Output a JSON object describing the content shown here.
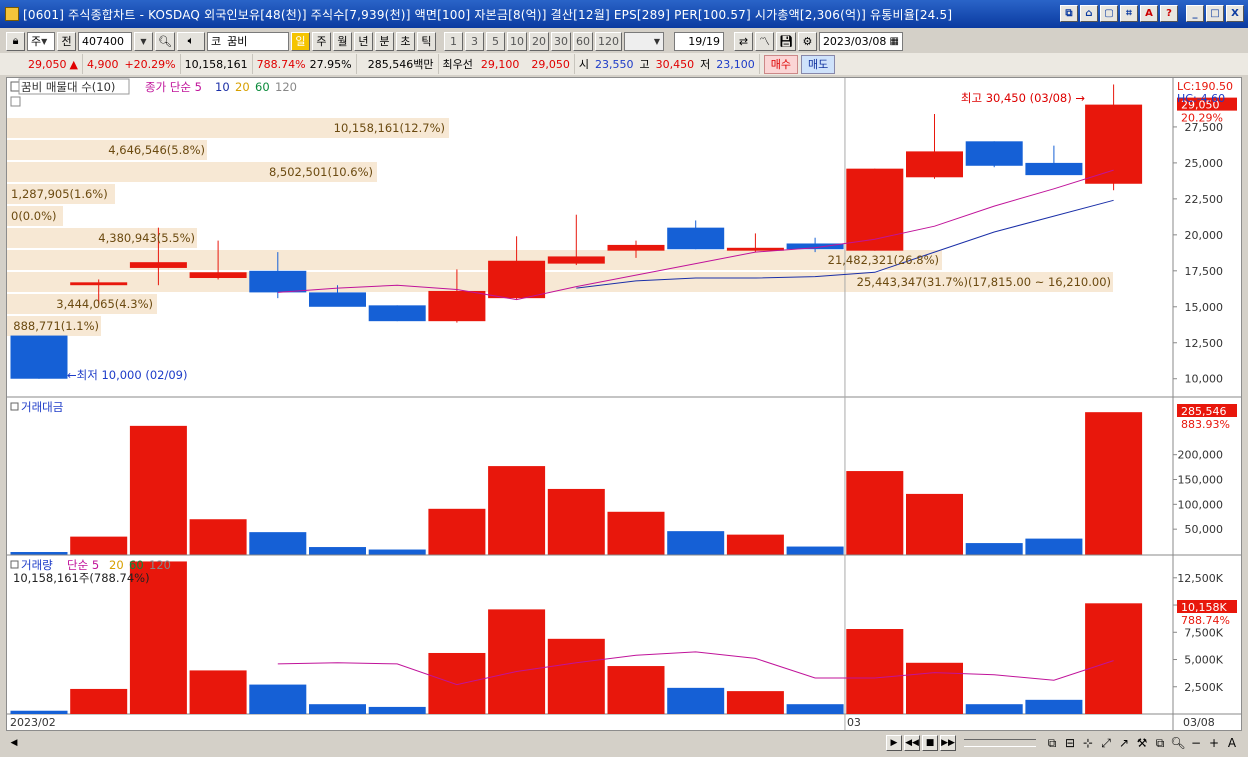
{
  "window": {
    "title": "[0601] 주식종합차트 - KOSDAQ 외국인보유[48(천)] 주식수[7,939(천)] 액면[100] 자본금[8(억)] 결산[12월] EPS[289] PER[100.57] 시가총액[2,306(억)] 유통비율[24.5]",
    "buttons": [
      "⧉",
      "⌂",
      "▢",
      "⌗",
      "A",
      "?",
      "_",
      "□",
      "X"
    ]
  },
  "toolbar": {
    "period_type": "주",
    "prev_label": "전",
    "code": "407400",
    "market": "코",
    "stock_name": "꿈비",
    "period_buttons": [
      "일",
      "주",
      "월",
      "년",
      "분",
      "초",
      "틱"
    ],
    "active_period": "일",
    "interval_buttons": [
      "1",
      "3",
      "5",
      "10",
      "20",
      "30",
      "60",
      "120"
    ],
    "count": "19",
    "count_total": "/19",
    "date": "2023/03/08"
  },
  "quote": {
    "price": "29,050",
    "up_arrow": "▲",
    "change": "4,900",
    "change_pct": "+20.29%",
    "volume": "10,158,161",
    "volume_ratio": "788.74%",
    "turnover": "27.95%",
    "amount": "285,546백만",
    "best_label": "최우선",
    "bid1": "29,100",
    "bid2": "29,050",
    "open_label": "시",
    "open": "23,550",
    "high_label": "고",
    "high": "30,450",
    "low_label": "저",
    "low": "23,100",
    "buy": "매수",
    "sell": "매도"
  },
  "price_panel": {
    "legend_name": "꿈비 매물대 수(10)",
    "legend_ma": "종가 단순 5",
    "ma_periods": [
      "10",
      "20",
      "60",
      "120"
    ],
    "lc": "LC:190.50",
    "hc": "HC:-4.60",
    "current": "29,050",
    "current_pct": "20.29%",
    "high_note": "최고 30,450 (03/08) →",
    "low_note": "←최저 10,000 (02/09)",
    "y_ticks": [
      "27,500",
      "25,000",
      "22,500",
      "20,000",
      "17,500",
      "15,000",
      "12,500",
      "10,000"
    ],
    "profile_labels": [
      "10,158,161(12.7%)",
      "4,646,546(5.8%)",
      "8,502,501(10.6%)",
      "1,287,905(1.6%)",
      "0(0.0%)",
      "4,380,943(5.5%)",
      "21,482,321(26.8%)",
      "25,443,347(31.7%)(17,815.00 ~ 16,210.00)",
      "3,444,065(4.3%)",
      "888,771(1.1%)"
    ]
  },
  "amount_panel": {
    "legend": "거래대금",
    "current": "285,546",
    "current_pct": "883.93%",
    "y_ticks": [
      "200,000",
      "150,000",
      "100,000",
      "50,000"
    ]
  },
  "volume_panel": {
    "legend": "거래량",
    "legend_ma": "단순 5",
    "ma_periods": [
      "20",
      "60",
      "120"
    ],
    "sub_label": "10,158,161주(788.74%)",
    "current": "10,158K",
    "current_pct": "788.74%",
    "y_ticks": [
      "12,500K",
      "10,000K",
      "7,500K",
      "5,000K",
      "2,500K"
    ]
  },
  "x_axis": {
    "left_label": "2023/02",
    "mid_label": "03",
    "right_label": "03/08"
  },
  "colors": {
    "up": "#e8170c",
    "down": "#1560d6",
    "ma5": "#c0139a",
    "ma10": "#1a2fa8",
    "profile": "#f7e8d4"
  },
  "chart_data": {
    "type": "candlestick",
    "dates": [
      "02/09",
      "02/10",
      "02/13",
      "02/14",
      "02/15",
      "02/16",
      "02/17",
      "02/20",
      "02/21",
      "02/22",
      "02/23",
      "02/24",
      "02/27",
      "02/28",
      "03/02",
      "03/03",
      "03/06",
      "03/07",
      "03/08"
    ],
    "ohlc": [
      [
        13000,
        13000,
        10000,
        10000
      ],
      [
        16500,
        16900,
        15200,
        16700
      ],
      [
        17700,
        20500,
        16500,
        18100
      ],
      [
        17000,
        19600,
        16900,
        17400
      ],
      [
        17500,
        18800,
        15600,
        16000
      ],
      [
        16000,
        16500,
        15100,
        15000
      ],
      [
        15100,
        15100,
        14000,
        14000
      ],
      [
        14000,
        17600,
        13900,
        16100
      ],
      [
        15600,
        19900,
        15500,
        18200
      ],
      [
        18000,
        21400,
        17900,
        18500
      ],
      [
        18900,
        19600,
        18400,
        19300
      ],
      [
        20500,
        21000,
        19000,
        19000
      ],
      [
        18900,
        20100,
        18800,
        19100
      ],
      [
        19400,
        19800,
        18800,
        19000
      ],
      [
        18900,
        24600,
        18900,
        24600
      ],
      [
        24000,
        28400,
        23900,
        25800
      ],
      [
        26500,
        26500,
        24700,
        24800
      ],
      [
        25000,
        26200,
        24200,
        24150
      ],
      [
        23550,
        30450,
        23100,
        29050
      ]
    ],
    "ma5": [
      null,
      null,
      null,
      null,
      16000,
      16300,
      16500,
      16200,
      15500,
      16400,
      17200,
      18000,
      18800,
      19100,
      19700,
      20600,
      22000,
      23200,
      24500
    ],
    "ma10": [
      null,
      null,
      null,
      null,
      null,
      null,
      null,
      null,
      null,
      16300,
      16800,
      17000,
      17000,
      17100,
      17400,
      18800,
      20200,
      21300,
      22400
    ],
    "amount_millions": [
      4000,
      35000,
      258000,
      70000,
      44000,
      14000,
      9000,
      91000,
      177000,
      131000,
      85000,
      46000,
      39000,
      15000,
      167000,
      121000,
      22000,
      31000,
      285546
    ],
    "volume_k": [
      300,
      2300,
      14000,
      4000,
      2700,
      900,
      650,
      5600,
      9600,
      6900,
      4400,
      2400,
      2100,
      900,
      7800,
      4700,
      900,
      1300,
      10158
    ],
    "volume_ma5": [
      null,
      null,
      null,
      null,
      4600,
      4700,
      4600,
      2700,
      3900,
      4700,
      5400,
      5700,
      5100,
      3300,
      3300,
      3800,
      3600,
      3100,
      4900
    ],
    "price_ylim": [
      8800,
      30900
    ],
    "amount_ylim": [
      0,
      285546
    ],
    "volume_ylim": [
      0,
      14500
    ]
  }
}
